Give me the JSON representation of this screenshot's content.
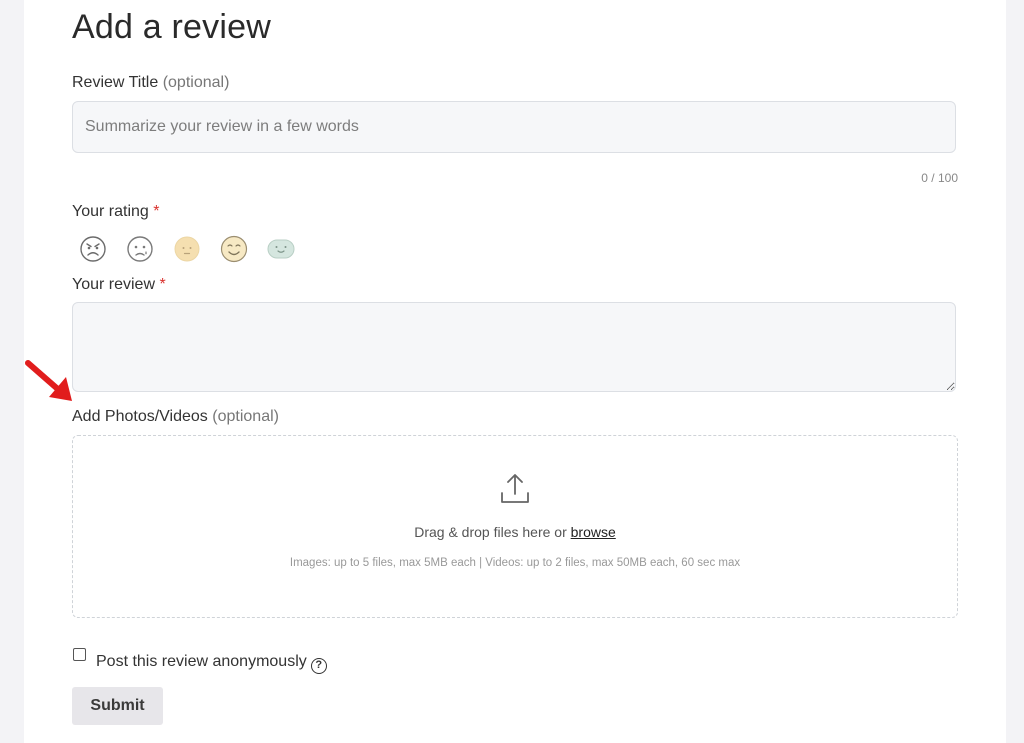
{
  "form": {
    "title": "Add a review",
    "review_title": {
      "label": "Review Title",
      "optional": "(optional)",
      "placeholder": "Summarize your review in a few words",
      "counter": "0 / 100"
    },
    "rating": {
      "label": "Your rating",
      "required_mark": "*",
      "faces": [
        "angry-face-icon",
        "sad-face-icon",
        "neutral-face-icon",
        "smile-face-icon",
        "happy-face-icon"
      ]
    },
    "review": {
      "label": "Your review",
      "required_mark": "*",
      "value": ""
    },
    "media": {
      "label": "Add Photos/Videos",
      "optional": "(optional)",
      "drop_text": "Drag & drop files here or",
      "browse": "browse",
      "hint": "Images: up to 5 files, max 5MB each | Videos: up to 2 files, max 50MB each, 60 sec max"
    },
    "anonymous": {
      "label": "Post this review anonymously",
      "help": "?",
      "checked": false
    },
    "submit_label": "Submit"
  },
  "colors": {
    "required": "#d9302c",
    "arrow": "#e11d1d",
    "face_neutral": "#f5dfb0",
    "face_smile": "#f7e9c4",
    "face_happy": "#d5e6df"
  }
}
